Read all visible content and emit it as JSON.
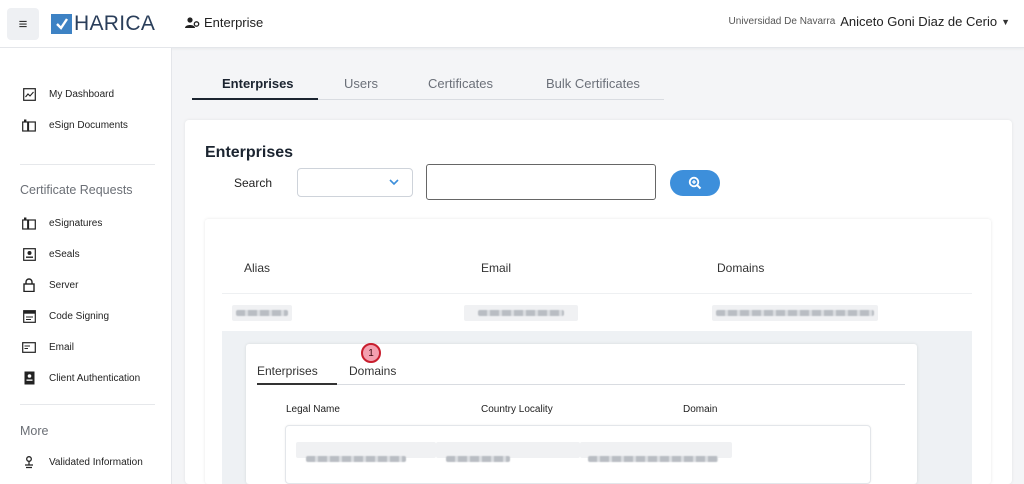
{
  "header": {
    "logo_text": "HARICA",
    "context_label": "Enterprise",
    "org_name": "Universidad De Navarra",
    "user_name": "Aniceto Goni Diaz de Cerio",
    "accent_color": "#3d82c4"
  },
  "sidebar": {
    "top_items": [
      {
        "label": "My Dashboard",
        "icon": "dashboard-icon"
      },
      {
        "label": "eSign Documents",
        "icon": "esign-documents-icon"
      }
    ],
    "cert_heading": "Certificate Requests",
    "cert_items": [
      {
        "label": "eSignatures",
        "icon": "esignature-icon"
      },
      {
        "label": "eSeals",
        "icon": "eseal-icon"
      },
      {
        "label": "Server",
        "icon": "lock-icon"
      },
      {
        "label": "Code Signing",
        "icon": "code-signing-icon"
      },
      {
        "label": "Email",
        "icon": "email-icon"
      },
      {
        "label": "Client Authentication",
        "icon": "client-auth-icon"
      }
    ],
    "more_heading": "More",
    "more_items": [
      {
        "label": "Validated Information",
        "icon": "validated-info-icon"
      }
    ]
  },
  "main": {
    "tabs": [
      "Enterprises",
      "Users",
      "Certificates",
      "Bulk Certificates"
    ],
    "active_tab": "Enterprises",
    "card_title": "Enterprises",
    "search": {
      "label": "Search",
      "select_value": "",
      "input_value": ""
    },
    "table": {
      "columns": [
        "Alias",
        "Email",
        "Domains"
      ]
    },
    "sub_tabs": [
      "Enterprises",
      "Domains"
    ],
    "sub_active_tab": "Enterprises",
    "badge_number": "1",
    "sub_table": {
      "columns": [
        "Legal Name",
        "Country Locality",
        "Domain"
      ]
    }
  }
}
